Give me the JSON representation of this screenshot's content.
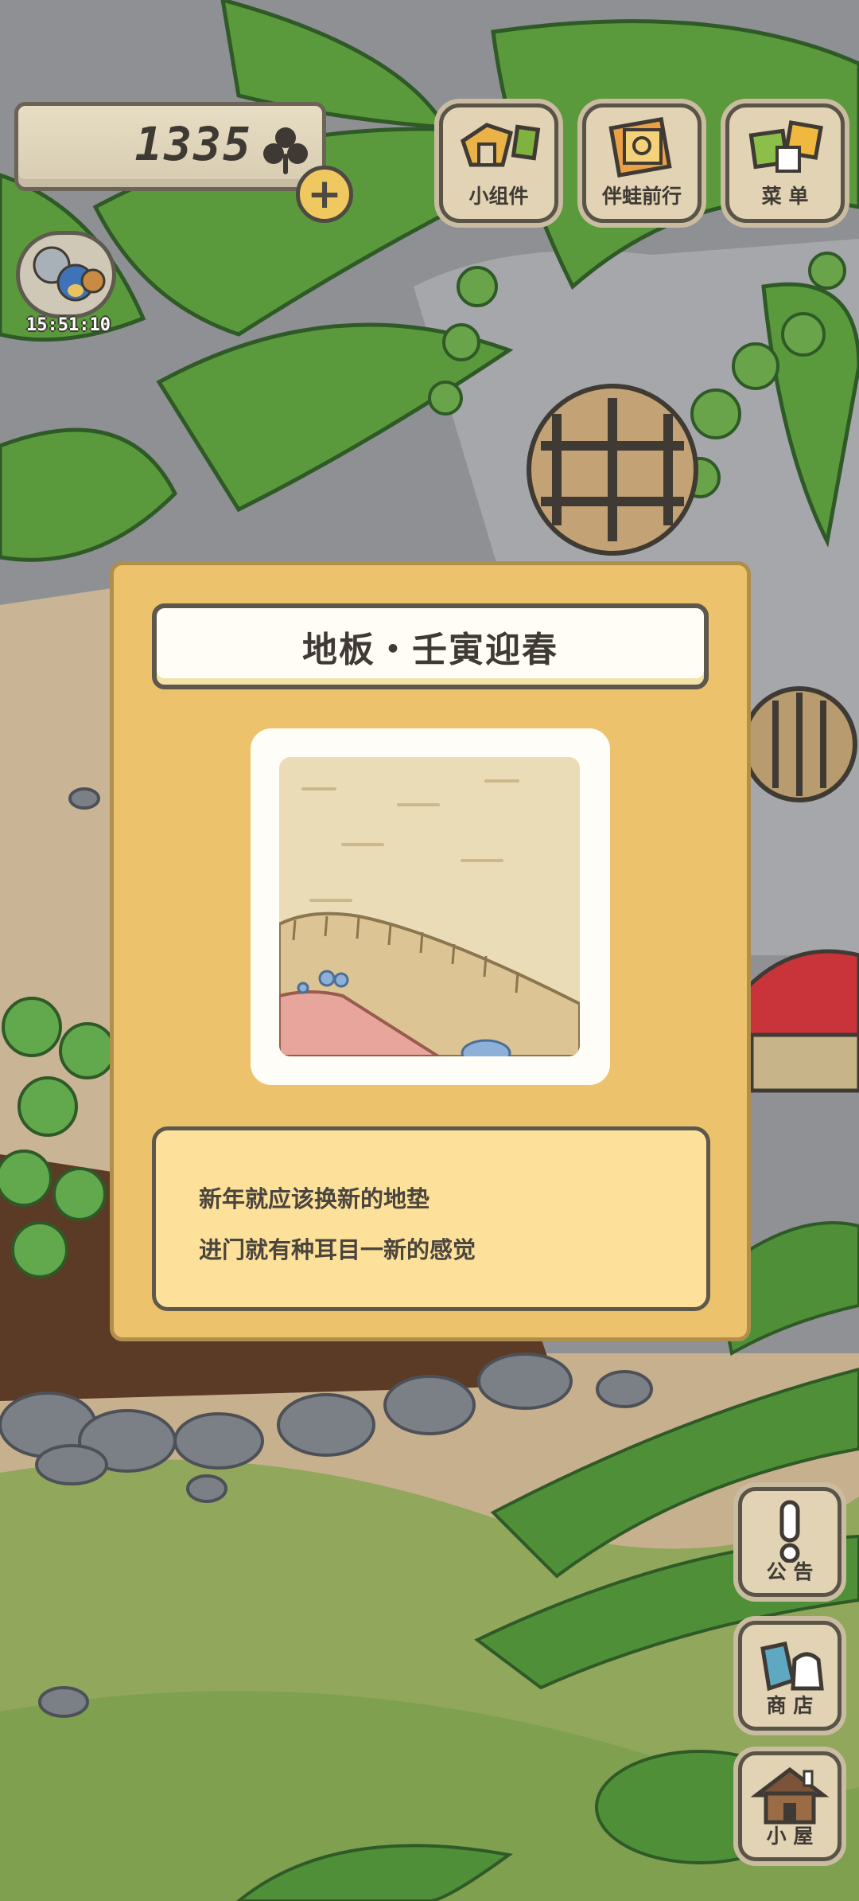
{
  "header": {
    "clover_count": "1335",
    "timer": "15:51:10"
  },
  "top_buttons": [
    {
      "label": "小组件",
      "icon": "widget-icon"
    },
    {
      "label": "伴蛙前行",
      "icon": "journey-album-icon"
    },
    {
      "label": "菜 单",
      "icon": "menu-cards-icon"
    }
  ],
  "side_buttons": [
    {
      "label": "公 告",
      "icon": "exclamation-icon"
    },
    {
      "label": "商 店",
      "icon": "shop-bags-icon"
    },
    {
      "label": "小 屋",
      "icon": "house-icon"
    }
  ],
  "dialog": {
    "title": "地板・壬寅迎春",
    "description": [
      "新年就应该换新的地垫",
      "进门就有种耳目一新的感觉"
    ]
  },
  "colors": {
    "dialog_bg": "#ecc36c",
    "desc_bg": "#fde19b",
    "wood": "#e1d3b4",
    "leaf": "#5a9a3c"
  }
}
